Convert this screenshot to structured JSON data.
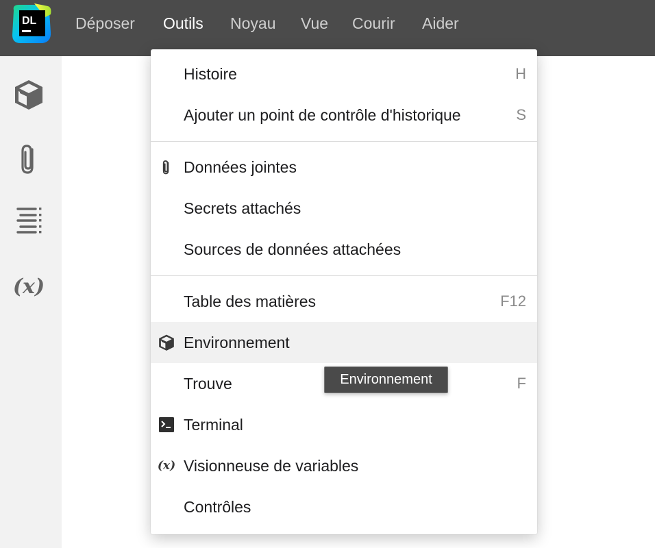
{
  "app": {
    "logo_text": "DL",
    "logo_icon": "datalore-logo"
  },
  "menubar": {
    "items": [
      {
        "label": "Déposer",
        "active": false
      },
      {
        "label": "Outils",
        "active": true
      },
      {
        "label": "Noyau",
        "active": false
      },
      {
        "label": "Vue",
        "active": false
      },
      {
        "label": "Courir",
        "active": false
      },
      {
        "label": "Aider",
        "active": false
      }
    ]
  },
  "sidebar": {
    "buttons": [
      {
        "icon": "environment-cube-icon"
      },
      {
        "icon": "paperclip-icon"
      },
      {
        "icon": "table-of-contents-icon"
      },
      {
        "icon": "variables-icon",
        "text": "(x)"
      }
    ]
  },
  "dropdown": {
    "items": [
      {
        "label": "Histoire",
        "shortcut": "H",
        "icon": null
      },
      {
        "label": "Ajouter un point de contrôle d'historique",
        "shortcut": "S",
        "icon": null
      },
      {
        "label": "Données jointes",
        "shortcut": "",
        "icon": "paperclip-icon"
      },
      {
        "label": "Secrets attachés",
        "shortcut": "",
        "icon": null
      },
      {
        "label": "Sources de données attachées",
        "shortcut": "",
        "icon": null
      },
      {
        "label": "Table des matières",
        "shortcut": "F12",
        "icon": null
      },
      {
        "label": "Environnement",
        "shortcut": "",
        "icon": "environment-cube-icon",
        "highlighted": true
      },
      {
        "label": "Trouve",
        "shortcut": "F",
        "icon": null
      },
      {
        "label": "Terminal",
        "shortcut": "",
        "icon": "terminal-icon"
      },
      {
        "label": "Visionneuse de variables",
        "shortcut": "",
        "icon": "variables-icon",
        "icon_text": "(x)"
      },
      {
        "label": "Contrôles",
        "shortcut": "",
        "icon": null
      }
    ]
  },
  "tooltip": {
    "text": "Environnement"
  },
  "colors": {
    "menubar_bg": "#4b4b4b",
    "menubar_text": "#cfcfcf",
    "menubar_active_text": "#ffffff",
    "sidebar_bg": "#f2f2f2",
    "highlight_bg": "#f1f1f1",
    "tooltip_bg": "#4a4a4a"
  }
}
